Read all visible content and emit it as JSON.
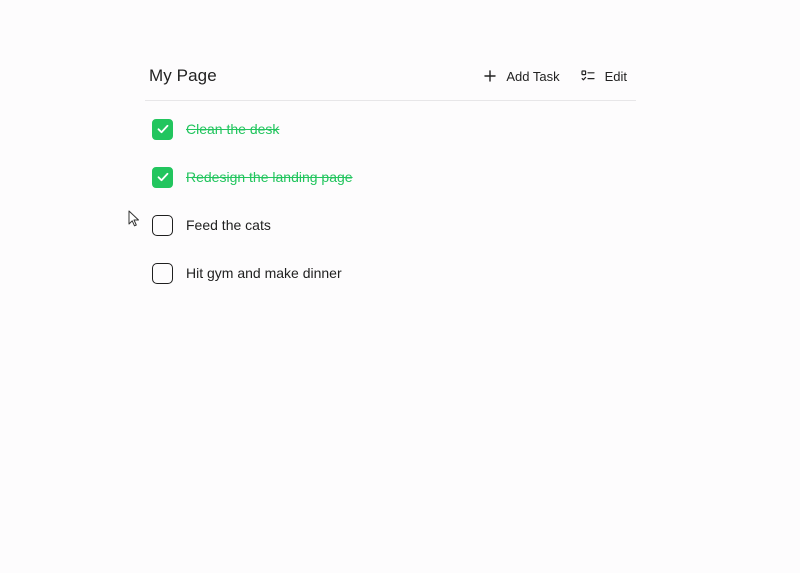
{
  "page": {
    "title": "My Page"
  },
  "toolbar": {
    "add_task": {
      "label": "Add Task",
      "icon": "plus-icon"
    },
    "edit": {
      "label": "Edit",
      "icon": "checklist-icon"
    }
  },
  "tasks": [
    {
      "label": "Clean the desk",
      "done": true
    },
    {
      "label": "Redesign the landing page",
      "done": true
    },
    {
      "label": "Feed the cats",
      "done": false
    },
    {
      "label": "Hit gym and make dinner",
      "done": false
    }
  ],
  "colors": {
    "done": "#22c55e",
    "text": "#1f1f1f",
    "divider": "#e7e6e8"
  }
}
